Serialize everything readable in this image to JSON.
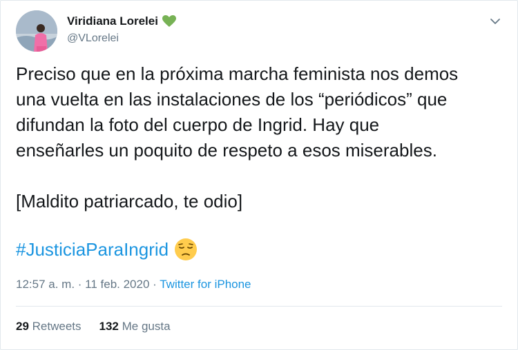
{
  "tweet": {
    "author": {
      "display_name": "Viridiana Lorelei",
      "badge_icon": "green-heart-icon",
      "handle": "@VLorelei"
    },
    "menu_icon": "chevron-down-icon",
    "text_lines": [
      "Preciso que en la próxima marcha feminista nos demos",
      "una vuelta en las instalaciones de los “periódicos” que",
      "difundan la foto del cuerpo de Ingrid. Hay que",
      "enseñarles un poquito de respeto a esos miserables."
    ],
    "text_line_2": "[Maldito patriarcado, te odio]",
    "hashtag": "#JusticiaParaIngrid",
    "hashtag_emoji_icon": "pensive-face-icon",
    "timestamp": "12:57 a. m. · 11 feb. 2020 · ",
    "source": "Twitter for iPhone",
    "stats": {
      "retweets_count": "29",
      "retweets_label": " Retweets",
      "likes_count": "132",
      "likes_label": " Me gusta"
    },
    "colors": {
      "link": "#1b95e0",
      "secondary_text": "#657786",
      "primary_text": "#14171a",
      "heart": "#77b255"
    }
  }
}
